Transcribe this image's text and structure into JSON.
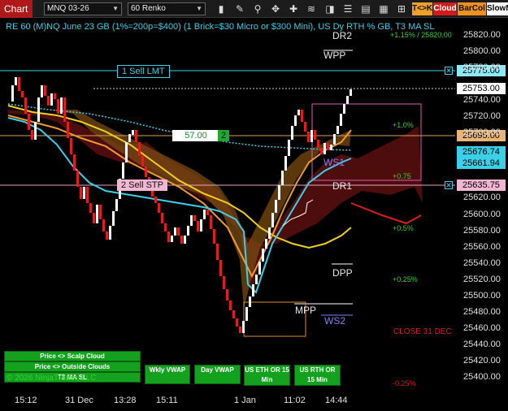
{
  "toolbar": {
    "chart_tab": "Chart",
    "instrument": "MNQ 03-26",
    "bar_type": "60 Renko",
    "tk_label": "T<>K",
    "cloud_label": "Cloud",
    "barcol_label": "BarCol",
    "slow_label": "SlowM",
    "colors": {
      "tab": "#b0191a",
      "tk": "#f0a028",
      "cloud": "#d21c1c",
      "barcol": "#f09020"
    }
  },
  "header_text": "RE 60 (M)NQ June 23 GB (1%=200p=$400) (1 Brick=$30 Micro or $300 Mini), US Dy RTH % GB, T3 MA SL",
  "orders": {
    "sell_lmt": {
      "label": "1 Sell LMT",
      "price": "25775.00"
    },
    "sell_stp": {
      "label": "2 Sell STP",
      "price": "25635.75"
    },
    "position": {
      "pnl": "57.00",
      "qty": "2",
      "price": "25695.00"
    }
  },
  "price_tags": {
    "last": "25753.00",
    "cyan1": "25676.74",
    "cyan2": "25661.94"
  },
  "pivots": {
    "dr2": "DR2",
    "wpp": "WPP",
    "ws1": "WS1",
    "dr1": "DR1",
    "dpp": "DPP",
    "mpp": "MPP",
    "ws2": "WS2"
  },
  "pct_labels": {
    "top": "+1.15% / 25820.00",
    "p1_0": "+1.0%",
    "p0_75": "+0.75",
    "p0_5": "+0.5%",
    "p0_25": "+0.25%",
    "n0_25": "-0.25%"
  },
  "close_label": "CLOSE 31 DEC",
  "y_axis": [
    "25820.00",
    "25800.00",
    "25780.00",
    "25740.00",
    "25720.00",
    "25700.00",
    "25620.00",
    "25600.00",
    "25580.00",
    "25560.00",
    "25540.00",
    "25520.00",
    "25500.00",
    "25480.00",
    "25460.00",
    "25440.00",
    "25420.00",
    "25400.00"
  ],
  "x_axis": [
    "15:12",
    "31 Dec",
    "13:28",
    "15:11",
    "1 Jan",
    "11:02",
    "14:44"
  ],
  "buttons": {
    "scalp": "Price <> Scalp Cloud",
    "outside": "Price <> Outside Clouds",
    "t3": "T3 MA SL",
    "wkly": "Wkly VWAP",
    "day": "Day VWAP",
    "eth": "US ETH OR 15 Min",
    "rth": "US RTH OR 15 Min"
  },
  "copyright": "© 2026 NinjaTrader, LLC"
}
